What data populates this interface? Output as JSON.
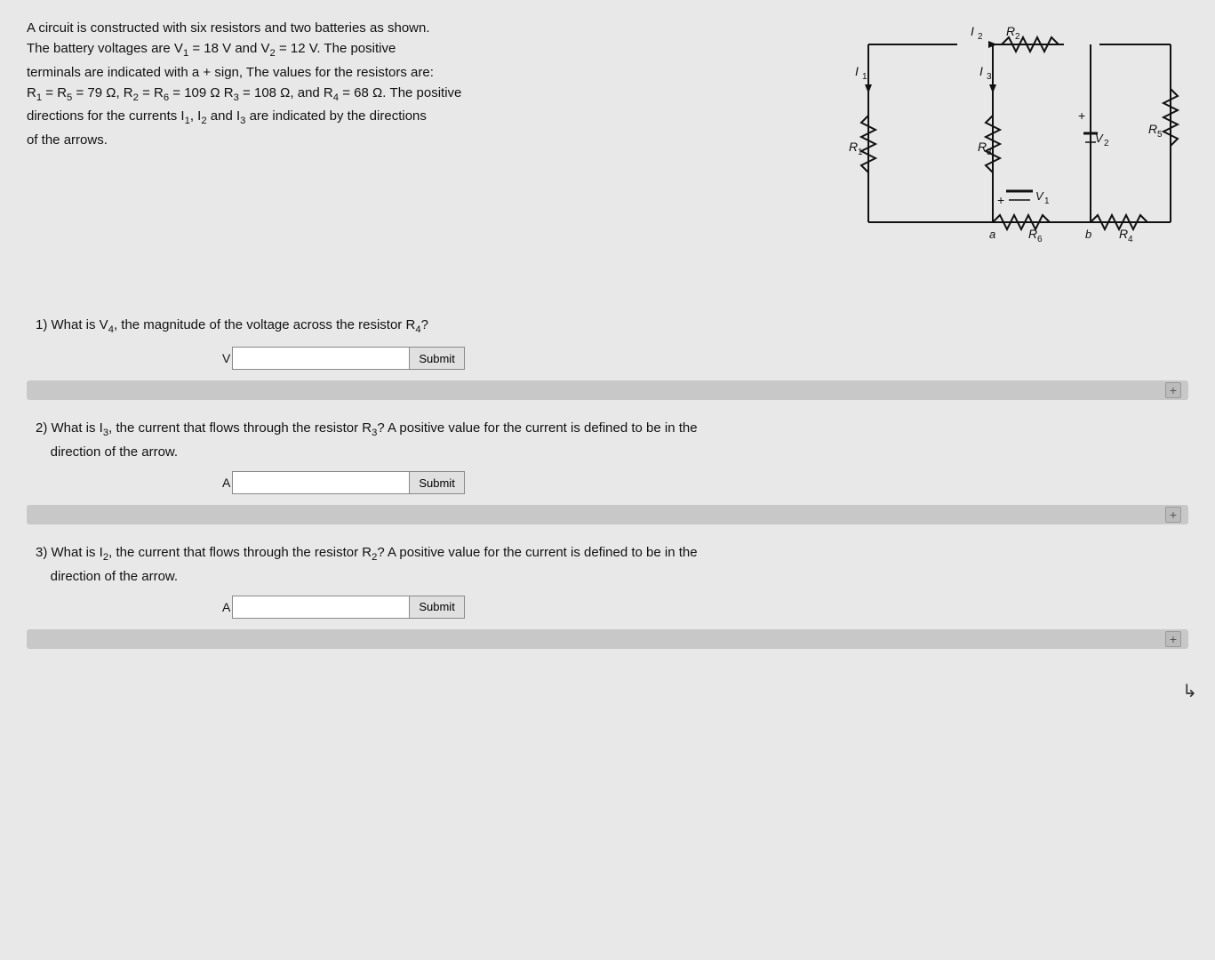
{
  "problem": {
    "description_lines": [
      "A circuit is constructed with six resistors and two batteries as shown.",
      "The battery voltages are V₁ = 18 V and V₂ = 12 V. The positive",
      "terminals are indicated with a + sign, The values for the resistors are:",
      "R₁ = R₅ = 79 Ω, R₂ = R₆ = 109 Ω R₃ = 108 Ω, and R₄ = 68 Ω. The positive",
      "directions for the currents I₁, I₂ and I₃ are indicated by the directions",
      "of the arrows."
    ]
  },
  "questions": [
    {
      "id": "q1",
      "number": "1",
      "text": "1) What is V₄, the magnitude of the voltage across the resistor R₄?",
      "unit": "V",
      "submit_label": "Submit",
      "input_value": ""
    },
    {
      "id": "q2",
      "number": "2",
      "text_line1": "2) What is I₃, the current that flows through the resistor R₃? A positive value for the current is defined to be in the",
      "text_line2": "direction of the arrow.",
      "unit": "A",
      "submit_label": "Submit",
      "input_value": ""
    },
    {
      "id": "q3",
      "number": "3",
      "text_line1": "3) What is I₂, the current that flows through the resistor R₂? A positive value for the current is defined to be in the",
      "text_line2": "direction of the arrow.",
      "unit": "A",
      "submit_label": "Submit",
      "input_value": ""
    }
  ],
  "colors": {
    "background": "#e8e8e8",
    "progress_bar": "#c0c0c0",
    "input_bg": "#ffffff",
    "button_bg": "#d8d8d8"
  }
}
